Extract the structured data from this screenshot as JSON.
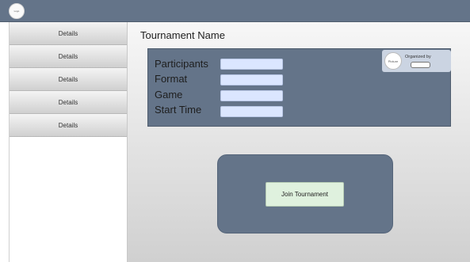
{
  "header": {
    "logo_text": "Logo"
  },
  "sidebar": {
    "items": [
      {
        "label": "Details"
      },
      {
        "label": "Details"
      },
      {
        "label": "Details"
      },
      {
        "label": "Details"
      },
      {
        "label": "Details"
      }
    ]
  },
  "main": {
    "title": "Tournament Name",
    "fields": [
      {
        "label": "Participants",
        "value": ""
      },
      {
        "label": "Format",
        "value": ""
      },
      {
        "label": "Game",
        "value": ""
      },
      {
        "label": "Start Time",
        "value": ""
      }
    ],
    "organizer": {
      "avatar_text": "Picture",
      "label": "Organized by",
      "value": ""
    },
    "join_button_label": "Join Tournament"
  },
  "colors": {
    "header_bg": "#647489",
    "panel_bg": "#647489",
    "input_bg": "#dbe6ff",
    "button_bg": "#dff1de"
  }
}
